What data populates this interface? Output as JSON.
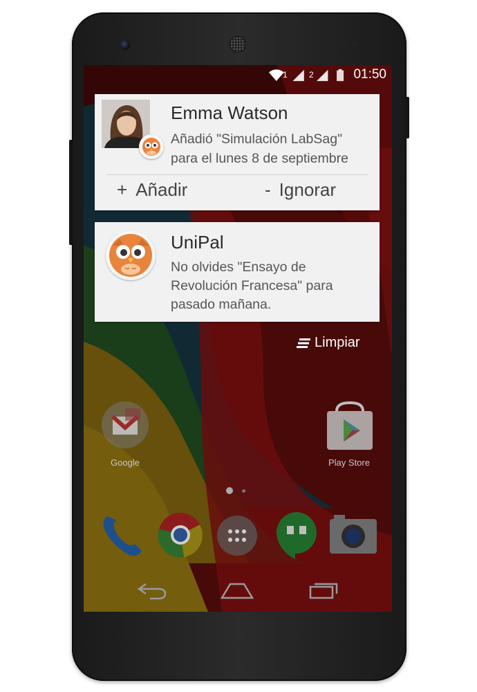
{
  "status_bar": {
    "sim1": "1",
    "sim2": "2",
    "time": "01:50"
  },
  "notifications": [
    {
      "title": "Emma Watson",
      "body_line1": "Añadió \"Simulación LabSag\"",
      "body_line2": "para el lunes 8 de septiembre",
      "actions": [
        {
          "symbol": "+",
          "label": "Añadir"
        },
        {
          "symbol": "-",
          "label": "Ignorar"
        }
      ]
    },
    {
      "title": "UniPal",
      "body_line1": "No olvides \"Ensayo de",
      "body_line2": "Revolución Francesa\" para",
      "body_line3": "pasado mañana."
    }
  ],
  "clear_label": "Limpiar",
  "home_apps": [
    {
      "label": "Google",
      "icon": "google-folder-icon"
    },
    {
      "label": "Play Store",
      "icon": "play-store-icon"
    }
  ],
  "dock": [
    "phone-icon",
    "chrome-icon",
    "app-drawer-icon",
    "hangouts-icon",
    "camera-icon"
  ],
  "nav": [
    "back-icon",
    "home-icon",
    "recents-icon"
  ],
  "colors": {
    "notification_bg": "#f1f1f1",
    "owl_orange": "#e8843c",
    "wallpaper_red": "#8c1212"
  }
}
